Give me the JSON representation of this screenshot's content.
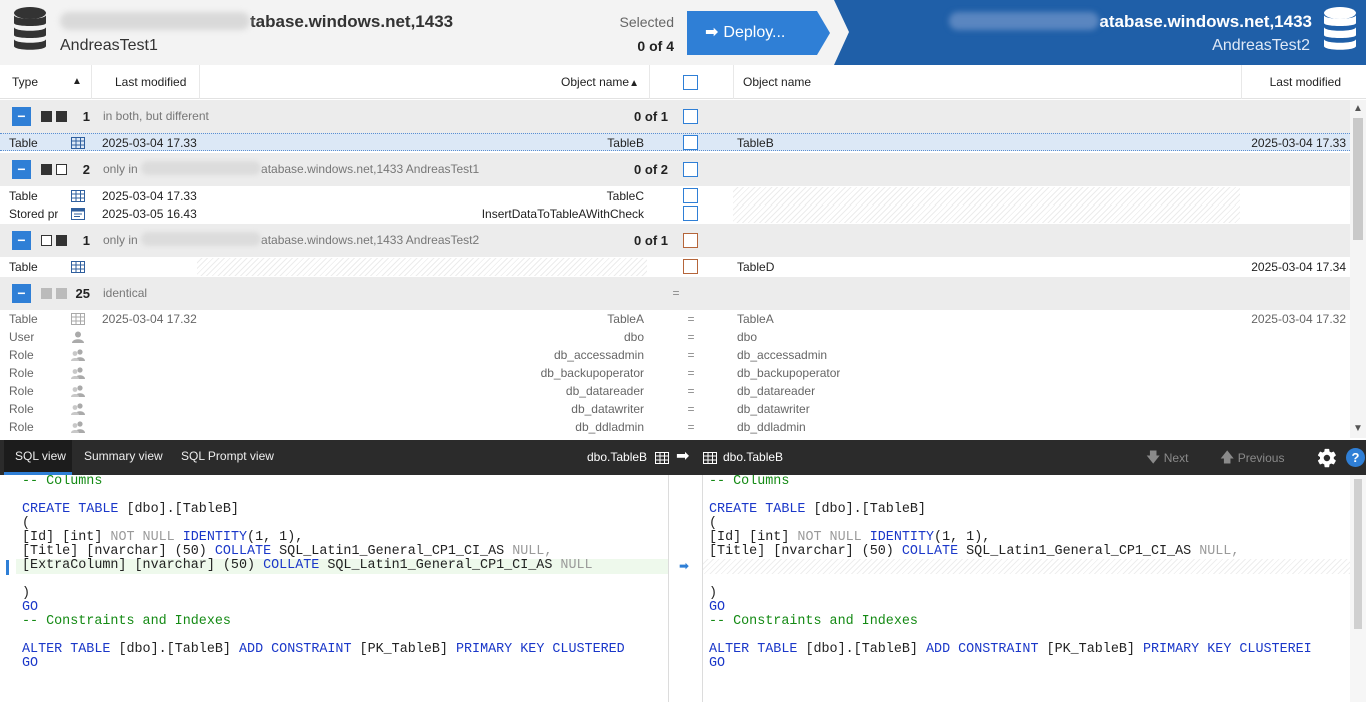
{
  "header": {
    "source_server_suffix": "tabase.windows.net,1433",
    "source_database": "AndreasTest1",
    "selected_label": "Selected",
    "selected_count": "0 of 4",
    "deploy_label": "Deploy...",
    "target_server_suffix": "atabase.windows.net,1433",
    "target_database": "AndreasTest2"
  },
  "columns": {
    "type": "Type",
    "last_modified_left": "Last modified",
    "object_name_left": "Object name",
    "object_name_right": "Object name",
    "last_modified_right": "Last modified"
  },
  "groups": [
    {
      "count": "1",
      "label": "in both, but different",
      "selected": "0 of 1",
      "items": [
        {
          "type": "Table",
          "modified_left": "2025-03-04 17.33",
          "name_left": "TableB",
          "name_right": "TableB",
          "modified_right": "2025-03-04 17.33"
        }
      ]
    },
    {
      "count": "2",
      "label_prefix": "only in",
      "label_suffix": "atabase.windows.net,1433 AndreasTest1",
      "selected": "0 of 2",
      "items": [
        {
          "type": "Table",
          "modified_left": "2025-03-04 17.33",
          "name_left": "TableC"
        },
        {
          "type": "Stored pr",
          "modified_left": "2025-03-05 16.43",
          "name_left": "InsertDataToTableAWithCheck"
        }
      ]
    },
    {
      "count": "1",
      "label_prefix": "only in",
      "label_suffix": "atabase.windows.net,1433 AndreasTest2",
      "selected": "0 of 1",
      "items": [
        {
          "type": "Table",
          "name_right": "TableD",
          "modified_right": "2025-03-04 17.34"
        }
      ]
    },
    {
      "count": "25",
      "label": "identical",
      "eq": "=",
      "items": [
        {
          "type": "Table",
          "modified_left": "2025-03-04 17.32",
          "name_left": "TableA",
          "name_right": "TableA",
          "modified_right": "2025-03-04 17.32"
        },
        {
          "type": "User",
          "name_left": "dbo",
          "name_right": "dbo"
        },
        {
          "type": "Role",
          "name_left": "db_accessadmin",
          "name_right": "db_accessadmin"
        },
        {
          "type": "Role",
          "name_left": "db_backupoperator",
          "name_right": "db_backupoperator"
        },
        {
          "type": "Role",
          "name_left": "db_datareader",
          "name_right": "db_datareader"
        },
        {
          "type": "Role",
          "name_left": "db_datawriter",
          "name_right": "db_datawriter"
        },
        {
          "type": "Role",
          "name_left": "db_ddladmin",
          "name_right": "db_ddladmin"
        }
      ]
    }
  ],
  "toolbar": {
    "tabs": [
      "SQL view",
      "Summary view",
      "SQL Prompt view"
    ],
    "left_object": "dbo.TableB",
    "right_object": "dbo.TableB",
    "next_label": "Next",
    "previous_label": "Previous"
  },
  "sql": {
    "comment_columns": "-- Columns",
    "create": "CREATE TABLE",
    "table_ref": " [dbo].[TableB]",
    "open_paren": "(",
    "id_col": "[Id] [int] ",
    "not_null": "NOT NULL ",
    "identity": "IDENTITY",
    "identity_args": "(1, 1),",
    "title_col": "[Title] [nvarchar] (50) ",
    "extra_col": "[ExtraColumn] [nvarchar] (50) ",
    "collate": "COLLATE",
    "collation": " SQL_Latin1_General_CP1_CI_AS ",
    "null_comma": "NULL,",
    "null": "NULL",
    "close_paren": ")",
    "go": "GO",
    "comment_constraints": "-- Constraints and Indexes",
    "alter": "ALTER TABLE",
    "add_constraint": "ADD CONSTRAINT",
    "pk_name": " [PK_TableB] ",
    "pk_clustered_left": "PRIMARY KEY CLUSTERED",
    "pk_clustered_right": "PRIMARY KEY CLUSTEREI"
  },
  "colors": {
    "accent": "#2f7fd6",
    "target_header": "#1f5fa8",
    "sql_keyword": "#1a37c9",
    "sql_comment": "#148a14",
    "orange_checkbox": "#b5653a"
  }
}
